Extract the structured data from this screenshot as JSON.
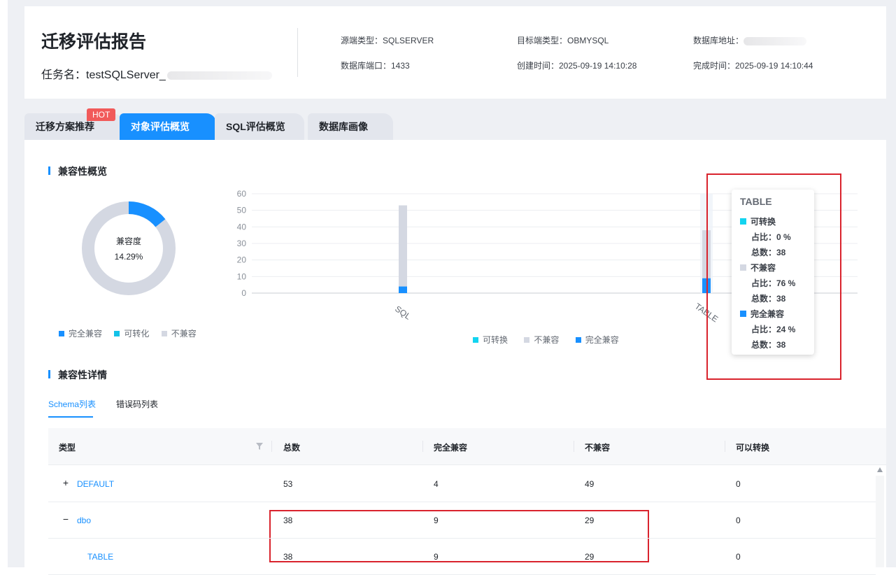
{
  "header": {
    "title": "迁移评估报告",
    "task_label": "任务名：testSQLServer_",
    "meta": {
      "source_type": "源端类型：SQLSERVER",
      "target_type": "目标端类型：OBMYSQL",
      "db_address": "数据库地址：",
      "db_port": "数据库端口：1433",
      "created": "创建时间：2025-09-19 14:10:28",
      "finished": "完成时间：2025-09-19 14:10:44"
    }
  },
  "tabs": [
    {
      "label": "迁移方案推荐",
      "badge": "HOT"
    },
    {
      "label": "对象评估概览",
      "active": true
    },
    {
      "label": "SQL评估概览"
    },
    {
      "label": "数据库画像"
    }
  ],
  "compat_overview": {
    "title": "兼容性概览",
    "donut": {
      "center_label": "兼容度",
      "center_value": "14.29%",
      "compatible_fraction": 0.1429,
      "colors": {
        "full": "#1890ff",
        "incompatible": "#d4d8e2"
      }
    },
    "legend": [
      {
        "label": "完全兼容",
        "color": "#1890ff"
      },
      {
        "label": "可转化",
        "color": "#13c2e8"
      },
      {
        "label": "不兼容",
        "color": "#d4d8e2"
      }
    ]
  },
  "chart_data": {
    "type": "bar",
    "categories": [
      "SQL",
      "TABLE"
    ],
    "series": [
      {
        "name": "可转换",
        "values": [
          0,
          0
        ],
        "color": "#13d4f0"
      },
      {
        "name": "不兼容",
        "values": [
          49,
          29
        ],
        "color": "#d4d8e2"
      },
      {
        "name": "完全兼容",
        "values": [
          4,
          9
        ],
        "color": "#1890ff"
      }
    ],
    "ylim": [
      0,
      60
    ],
    "yticks": [
      "0",
      "10",
      "20",
      "30",
      "40",
      "50",
      "60"
    ],
    "legend": [
      "可转换",
      "不兼容",
      "完全兼容"
    ],
    "legend_position": "bottom",
    "grid": true
  },
  "tooltip": {
    "title": "TABLE",
    "items": [
      {
        "name": "可转换",
        "ratio": "占比：0 %",
        "total": "总数：38",
        "color": "#13d4f0"
      },
      {
        "name": "不兼容",
        "ratio": "占比：76 %",
        "total": "总数：38",
        "color": "#d4d8e2"
      },
      {
        "name": "完全兼容",
        "ratio": "占比：24 %",
        "total": "总数：38",
        "color": "#1890ff"
      }
    ]
  },
  "compat_detail": {
    "title": "兼容性详情",
    "subtabs": [
      {
        "label": "Schema列表",
        "active": true
      },
      {
        "label": "错误码列表"
      }
    ],
    "columns": [
      "类型",
      "总数",
      "完全兼容",
      "不兼容",
      "可以转换"
    ],
    "rows": [
      {
        "expander": "+",
        "name": "DEFAULT",
        "total": "53",
        "full": "4",
        "incompatible": "49",
        "convertible": "0"
      },
      {
        "expander": "−",
        "name": "dbo",
        "total": "38",
        "full": "9",
        "incompatible": "29",
        "convertible": "0"
      },
      {
        "expander": "",
        "name": "TABLE",
        "total": "38",
        "full": "9",
        "incompatible": "29",
        "convertible": "0"
      }
    ]
  }
}
